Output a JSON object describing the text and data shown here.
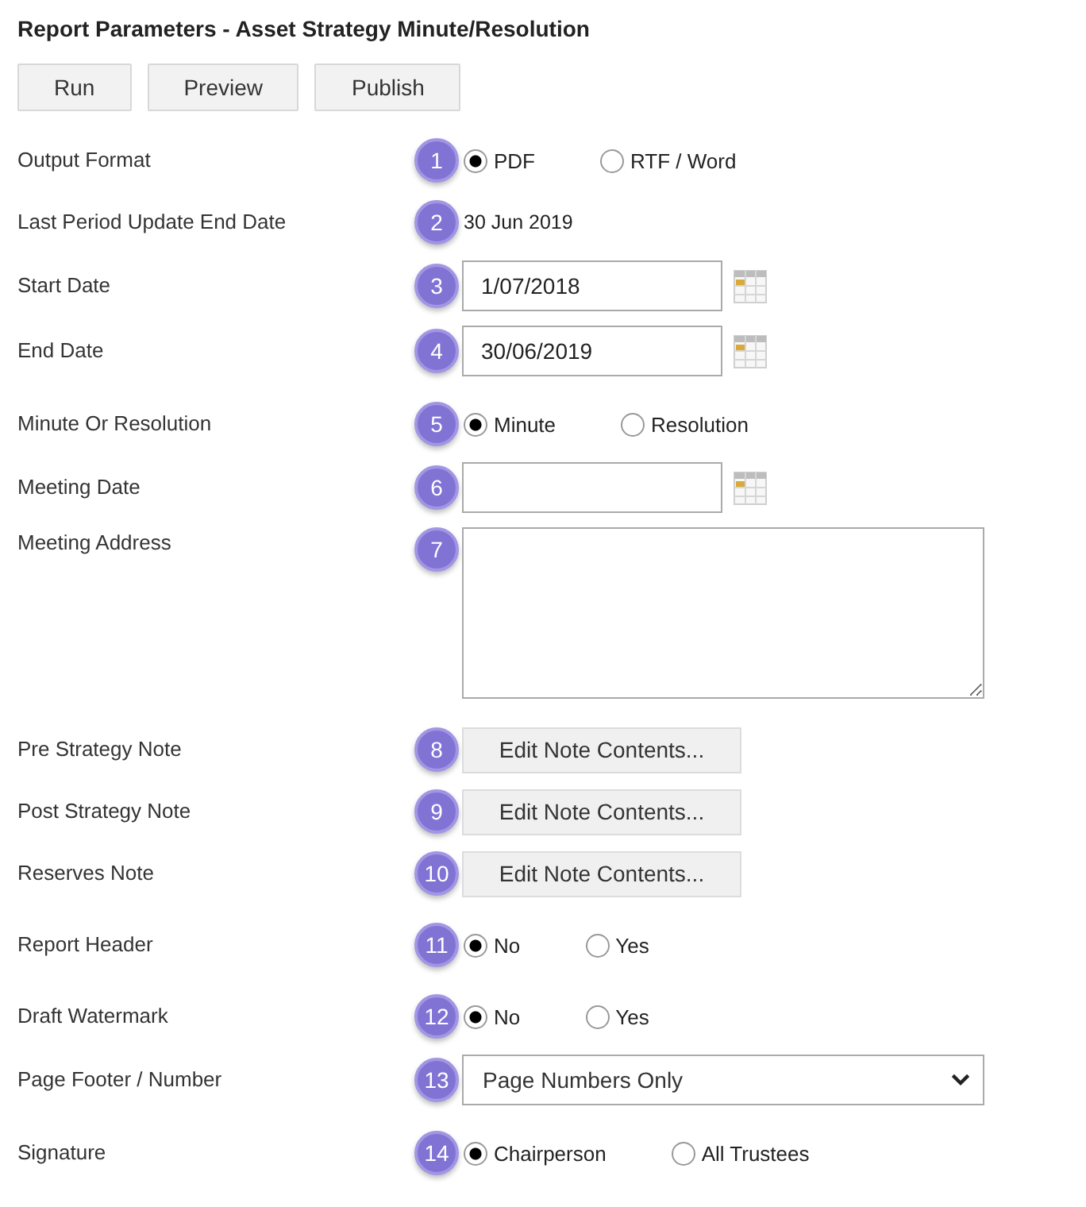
{
  "title": "Report Parameters - Asset Strategy Minute/Resolution",
  "buttons": [
    "Run",
    "Preview",
    "Publish"
  ],
  "parameters": [
    {
      "kind": "radio",
      "label": "Output Format",
      "badge": "1",
      "options": [
        {
          "label": "PDF",
          "selected": true
        },
        {
          "label": "RTF / Word",
          "selected": false
        }
      ]
    },
    {
      "kind": "text",
      "label": "Last Period Update End Date",
      "badge": "2",
      "value": "30 Jun 2019"
    },
    {
      "kind": "date",
      "label": "Start Date",
      "badge": "3",
      "value": "1/07/2018"
    },
    {
      "kind": "date",
      "label": "End Date",
      "badge": "4",
      "value": "30/06/2019"
    },
    {
      "kind": "radio",
      "label": "Minute Or Resolution",
      "badge": "5",
      "options": [
        {
          "label": "Minute",
          "selected": true
        },
        {
          "label": "Resolution",
          "selected": false
        }
      ]
    },
    {
      "kind": "date",
      "label": "Meeting Date",
      "badge": "6"
    },
    {
      "kind": "textarea",
      "label": "Meeting Address",
      "badge": "7"
    },
    {
      "kind": "note",
      "label": "Pre Strategy Note",
      "badge": "8",
      "button": "Edit Note Contents..."
    },
    {
      "kind": "note",
      "label": "Post Strategy Note",
      "badge": "9",
      "button": "Edit Note Contents..."
    },
    {
      "kind": "note",
      "label": "Reserves Note",
      "badge": "10",
      "button": "Edit Note Contents..."
    },
    {
      "kind": "radio",
      "label": "Report Header",
      "badge": "11",
      "options": [
        {
          "label": "No",
          "selected": true
        },
        {
          "label": "Yes",
          "selected": false
        }
      ]
    },
    {
      "kind": "radio",
      "label": "Draft Watermark",
      "badge": "12",
      "options": [
        {
          "label": "No",
          "selected": true
        },
        {
          "label": "Yes",
          "selected": false
        }
      ]
    },
    {
      "kind": "select",
      "label": "Page Footer / Number",
      "badge": "13",
      "value": "Page Numbers Only"
    },
    {
      "kind": "radio",
      "label": "Signature",
      "badge": "14",
      "options": [
        {
          "label": "Chairperson",
          "selected": true
        },
        {
          "label": "All Trustees",
          "selected": false
        }
      ]
    }
  ]
}
